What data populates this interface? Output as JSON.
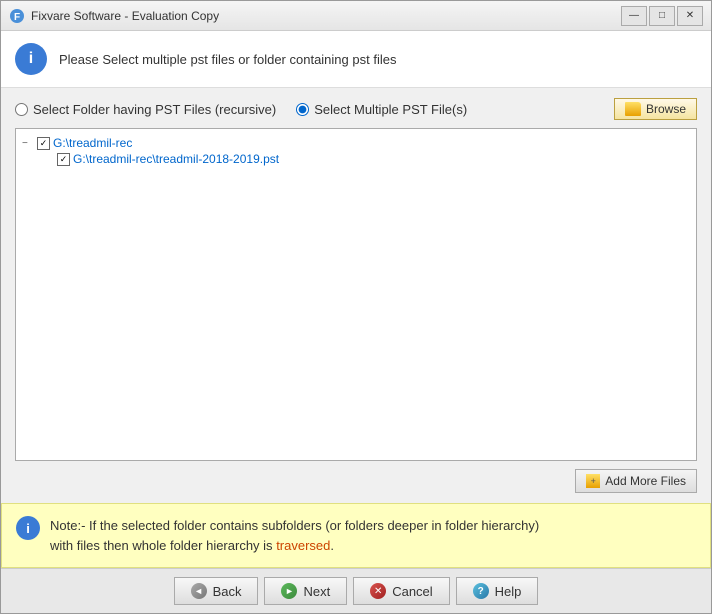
{
  "window": {
    "title": "Fixvare Software - Evaluation Copy"
  },
  "header": {
    "message": "Please Select multiple pst files or folder containing pst files"
  },
  "radio_options": {
    "option1": {
      "label": "Select Folder having PST Files (recursive)",
      "name": "radio-folder",
      "selected": false
    },
    "option2": {
      "label": "Select Multiple PST File(s)",
      "name": "radio-files",
      "selected": true
    }
  },
  "browse_button": {
    "label": "Browse"
  },
  "file_tree": {
    "root": {
      "path": "G:\\treadmil-rec",
      "children": [
        {
          "path": "G:\\treadmil-rec\\treadmil-2018-2019.pst"
        }
      ]
    }
  },
  "add_more_files": {
    "label": "Add More Files"
  },
  "note": {
    "prefix": "Note:- If the selected folder contains subfolders (or folders deeper in folder hierarchy)",
    "suffix": "with files then whole folder hierarchy is",
    "highlight": "traversed",
    "end": "."
  },
  "footer": {
    "back_label": "Back",
    "next_label": "Next",
    "cancel_label": "Cancel",
    "help_label": "Help"
  },
  "icons": {
    "info": "i",
    "minimize": "—",
    "maximize": "□",
    "close": "✕",
    "back_arrow": "◄",
    "next_arrow": "►",
    "cancel_x": "✕",
    "help_q": "?"
  }
}
